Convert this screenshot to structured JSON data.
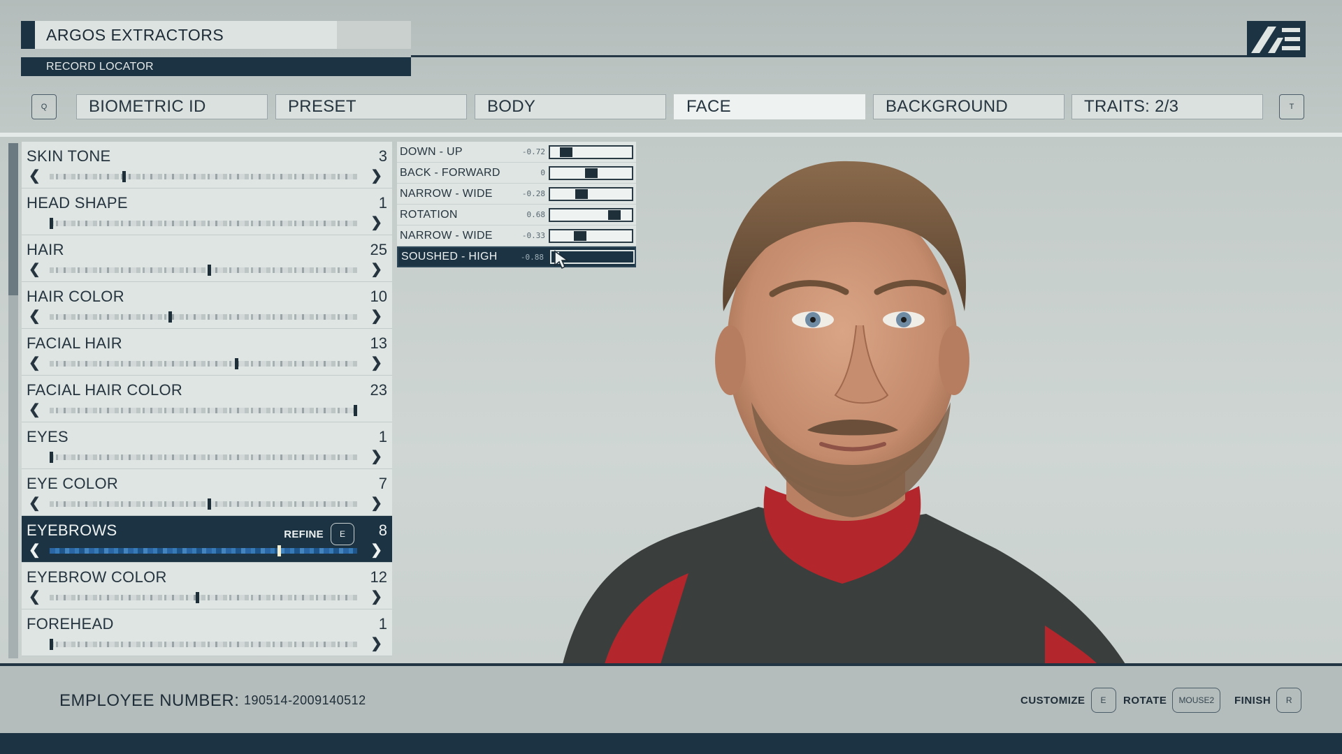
{
  "header": {
    "title": "ARGOS EXTRACTORS",
    "subtitle": "RECORD LOCATOR",
    "logo_icon": "constellation-logo"
  },
  "tabs": {
    "prev_key": "Q",
    "next_key": "T",
    "items": [
      {
        "label": "BIOMETRIC ID",
        "active": false
      },
      {
        "label": "PRESET",
        "active": false
      },
      {
        "label": "BODY",
        "active": false
      },
      {
        "label": "FACE",
        "active": true
      },
      {
        "label": "BACKGROUND",
        "active": false
      },
      {
        "label": "TRAITS: 2/3",
        "active": false
      }
    ]
  },
  "features": {
    "refine_label": "REFINE",
    "refine_key": "E",
    "items": [
      {
        "name": "SKIN TONE",
        "value": "3",
        "level": 0.24,
        "left_arrow": true,
        "right_arrow": true
      },
      {
        "name": "HEAD SHAPE",
        "value": "1",
        "level": 0.0,
        "left_arrow": false,
        "right_arrow": true
      },
      {
        "name": "HAIR",
        "value": "25",
        "level": 0.52,
        "left_arrow": true,
        "right_arrow": true
      },
      {
        "name": "HAIR COLOR",
        "value": "10",
        "level": 0.39,
        "left_arrow": true,
        "right_arrow": true
      },
      {
        "name": "FACIAL HAIR",
        "value": "13",
        "level": 0.61,
        "left_arrow": true,
        "right_arrow": true
      },
      {
        "name": "FACIAL HAIR COLOR",
        "value": "23",
        "level": 1.0,
        "left_arrow": true,
        "right_arrow": false
      },
      {
        "name": "EYES",
        "value": "1",
        "level": 0.0,
        "left_arrow": false,
        "right_arrow": true
      },
      {
        "name": "EYE COLOR",
        "value": "7",
        "level": 0.52,
        "left_arrow": true,
        "right_arrow": true
      },
      {
        "name": "EYEBROWS",
        "value": "8",
        "level": 0.75,
        "left_arrow": true,
        "right_arrow": true,
        "selected": true
      },
      {
        "name": "EYEBROW COLOR",
        "value": "12",
        "level": 0.48,
        "left_arrow": true,
        "right_arrow": true
      },
      {
        "name": "FOREHEAD",
        "value": "1",
        "level": 0.0,
        "left_arrow": false,
        "right_arrow": true
      }
    ]
  },
  "sliders": [
    {
      "label": "DOWN - UP",
      "value": "-0.72",
      "level": 0.14
    },
    {
      "label": "BACK - FORWARD",
      "value": "0",
      "level": 0.5
    },
    {
      "label": "NARROW - WIDE",
      "value": "-0.28",
      "level": 0.36
    },
    {
      "label": "ROTATION",
      "value": "0.68",
      "level": 0.84
    },
    {
      "label": "NARROW - WIDE",
      "value": "-0.33",
      "level": 0.34
    },
    {
      "label": "SOUSHED - HIGH",
      "value": "-0.88",
      "level": 0.06,
      "selected": true
    }
  ],
  "footer": {
    "employee_label": "EMPLOYEE NUMBER:",
    "employee_number": "190514-2009140512",
    "controls": [
      {
        "label": "CUSTOMIZE",
        "key": "E"
      },
      {
        "label": "ROTATE",
        "key": "MOUSE2"
      },
      {
        "label": "FINISH",
        "key": "R"
      }
    ]
  },
  "colors": {
    "accent_dark": "#1c3343",
    "panel_light": "#dfe5e3",
    "shirt_red": "#b3262c"
  }
}
